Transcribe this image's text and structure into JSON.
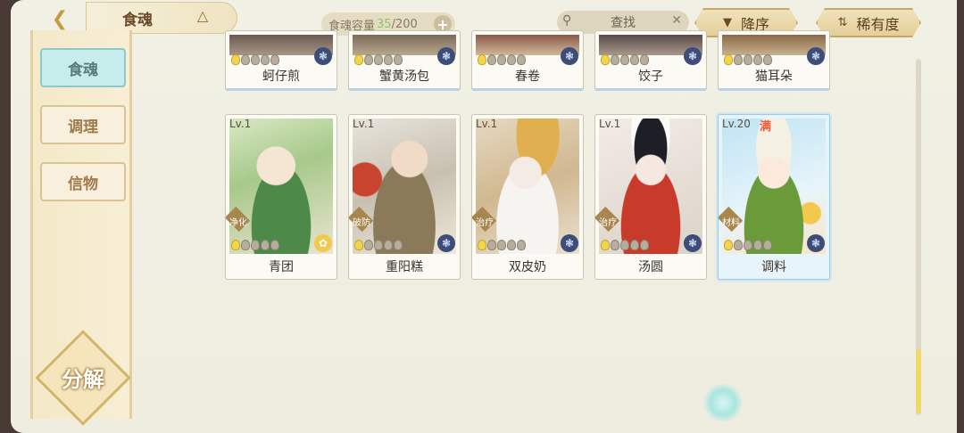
{
  "header": {
    "title": "食魂",
    "capacity_label": "食魂容量",
    "capacity_current": "35",
    "capacity_total": "/200",
    "search_label": "查找",
    "sort_order_label": "降序",
    "sort_rarity_label": "稀有度"
  },
  "sidebar": {
    "tabs": [
      {
        "label": "食魂",
        "active": true
      },
      {
        "label": "调理",
        "active": false
      },
      {
        "label": "信物",
        "active": false
      }
    ],
    "decompose_label": "分解"
  },
  "top_row": [
    {
      "name": "蚵仔煎",
      "element": "night"
    },
    {
      "name": "蟹黄汤包",
      "element": "night"
    },
    {
      "name": "春卷",
      "element": "night"
    },
    {
      "name": "饺子",
      "element": "night"
    },
    {
      "name": "猫耳朵",
      "element": "night"
    }
  ],
  "cards": [
    {
      "level": "Lv.1",
      "role": "净化",
      "name": "青团",
      "stars": 1,
      "element": "day",
      "max": ""
    },
    {
      "level": "Lv.1",
      "role": "破防",
      "name": "重阳糕",
      "stars": 1,
      "element": "night",
      "max": ""
    },
    {
      "level": "Lv.1",
      "role": "治疗",
      "name": "双皮奶",
      "stars": 1,
      "element": "night",
      "max": ""
    },
    {
      "level": "Lv.1",
      "role": "治疗",
      "name": "汤圆",
      "stars": 1,
      "element": "night",
      "max": ""
    },
    {
      "level": "Lv.20",
      "role": "材料",
      "name": "调料",
      "stars": 1,
      "element": "night",
      "max": "满"
    }
  ],
  "colors": {
    "background": "#efeee1",
    "active_tab": "#c7ecec",
    "accent_gold": "#d6b56a",
    "capacity_current": "#8fc46a"
  }
}
